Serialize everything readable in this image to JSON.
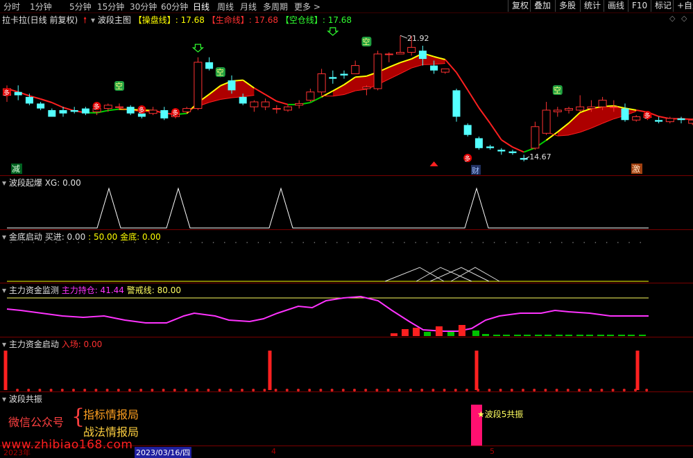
{
  "tabs": [
    "分时",
    "1分钟",
    "5分钟",
    "15分钟",
    "30分钟",
    "60分钟",
    "日线",
    "周线",
    "月线",
    "多周期",
    "更多 >"
  ],
  "active_tab": "日线",
  "right_buttons": [
    "复权",
    "叠加",
    "多股",
    "统计",
    "画线",
    "F10",
    "标记",
    "+自选"
  ],
  "main_title": {
    "stock": "拉卡拉(日线 前复权)",
    "indicator": "波段主图",
    "line1_label": "【操盘线】",
    "line1_value": ": 17.68",
    "line2_label": "【生命线】",
    "line2_value": ": 17.68",
    "line3_label": "【空仓线】",
    "line3_value": ": 17.68"
  },
  "main_annotations": {
    "high_label": "21.92",
    "low_label": "14.67",
    "jian": "减",
    "ji": "激",
    "cai": "财",
    "duo": "多",
    "kong": "空"
  },
  "panels": {
    "p1": {
      "name": "波段起爆",
      "l1": "XG: 0.00"
    },
    "p2": {
      "name": "金底启动",
      "l1": "买进: 0.00",
      "l2": ": 50.00",
      "l3": "金底: 0.00"
    },
    "p3": {
      "name": "主力资金监测",
      "l1": "主力持仓: 41.44",
      "l2": "警戒线: 80.00"
    },
    "p4": {
      "name": "主力资金启动",
      "l1": "入场: 0.00"
    },
    "p5": {
      "name": "波段共振"
    }
  },
  "overlay": {
    "wechat": "微信公众号",
    "brace": "{",
    "line1": "指标情报局",
    "line2": "战法情报局",
    "resonance": "★波段5共振",
    "website": "www.zhibiao168.com"
  },
  "xaxis": {
    "year": "2023年",
    "date": "2023/03/16/四",
    "m4": "4",
    "m5": "5"
  },
  "colors": {
    "up": "#ff3232",
    "down": "#54ffff",
    "ma_yellow": "#ffff00",
    "ma_green": "#00d000",
    "ma_red": "#ff2020",
    "band": "#c00000",
    "magenta": "#ff33ff",
    "pink": "#ff1070"
  },
  "chart_data": {
    "type": "candlestick",
    "candles": [
      {
        "o": 18.3,
        "h": 18.9,
        "l": 17.9,
        "c": 18.7
      },
      {
        "o": 18.5,
        "h": 18.9,
        "l": 18.0,
        "c": 18.3
      },
      {
        "o": 18.2,
        "h": 18.4,
        "l": 17.7,
        "c": 17.8
      },
      {
        "o": 17.8,
        "h": 17.9,
        "l": 17.4,
        "c": 17.5
      },
      {
        "o": 17.4,
        "h": 17.5,
        "l": 17.0,
        "c": 17.0
      },
      {
        "o": 17.4,
        "h": 17.6,
        "l": 17.0,
        "c": 17.2
      },
      {
        "o": 17.4,
        "h": 17.6,
        "l": 17.2,
        "c": 17.3
      },
      {
        "o": 17.5,
        "h": 17.6,
        "l": 17.1,
        "c": 17.2
      },
      {
        "o": 17.3,
        "h": 17.6,
        "l": 17.1,
        "c": 17.5
      },
      {
        "o": 17.5,
        "h": 17.8,
        "l": 17.3,
        "c": 17.7
      },
      {
        "o": 17.6,
        "h": 17.8,
        "l": 17.4,
        "c": 17.6
      },
      {
        "o": 17.6,
        "h": 17.7,
        "l": 17.1,
        "c": 17.2
      },
      {
        "o": 17.2,
        "h": 17.3,
        "l": 16.9,
        "c": 17.0
      },
      {
        "o": 17.2,
        "h": 17.6,
        "l": 17.1,
        "c": 17.4
      },
      {
        "o": 17.4,
        "h": 17.6,
        "l": 16.8,
        "c": 16.9
      },
      {
        "o": 17.0,
        "h": 17.3,
        "l": 16.9,
        "c": 17.2
      },
      {
        "o": 17.3,
        "h": 17.6,
        "l": 17.2,
        "c": 17.5
      },
      {
        "o": 17.5,
        "h": 20.6,
        "l": 17.4,
        "c": 20.3
      },
      {
        "o": 20.3,
        "h": 20.6,
        "l": 19.8,
        "c": 19.9
      },
      {
        "o": 19.8,
        "h": 19.9,
        "l": 19.4,
        "c": 19.5
      },
      {
        "o": 19.2,
        "h": 19.5,
        "l": 18.4,
        "c": 18.6
      },
      {
        "o": 18.2,
        "h": 18.4,
        "l": 17.7,
        "c": 17.8
      },
      {
        "o": 17.6,
        "h": 18.0,
        "l": 17.3,
        "c": 17.9
      },
      {
        "o": 17.6,
        "h": 18.1,
        "l": 17.4,
        "c": 17.9
      },
      {
        "o": 17.5,
        "h": 17.7,
        "l": 17.2,
        "c": 17.5
      },
      {
        "o": 17.4,
        "h": 17.7,
        "l": 17.3,
        "c": 17.6
      },
      {
        "o": 17.7,
        "h": 18.0,
        "l": 17.5,
        "c": 17.8
      },
      {
        "o": 18.0,
        "h": 18.7,
        "l": 17.9,
        "c": 18.5
      },
      {
        "o": 18.5,
        "h": 19.9,
        "l": 18.3,
        "c": 19.6
      },
      {
        "o": 19.4,
        "h": 19.8,
        "l": 19.0,
        "c": 19.3
      },
      {
        "o": 19.6,
        "h": 19.8,
        "l": 19.3,
        "c": 19.5
      },
      {
        "o": 19.6,
        "h": 20.4,
        "l": 19.6,
        "c": 20.1
      },
      {
        "o": 18.7,
        "h": 18.9,
        "l": 18.3,
        "c": 18.8
      },
      {
        "o": 18.7,
        "h": 21.0,
        "l": 18.6,
        "c": 20.8
      },
      {
        "o": 20.8,
        "h": 20.9,
        "l": 20.3,
        "c": 20.8
      },
      {
        "o": 20.8,
        "h": 21.9,
        "l": 20.8,
        "c": 20.9
      },
      {
        "o": 20.9,
        "h": 21.9,
        "l": 20.7,
        "c": 21.2
      },
      {
        "o": 21.0,
        "h": 21.3,
        "l": 20.1,
        "c": 20.5
      },
      {
        "o": 20.1,
        "h": 20.4,
        "l": 19.6,
        "c": 19.8
      },
      {
        "o": 19.7,
        "h": 19.9,
        "l": 19.6,
        "c": 19.9
      },
      {
        "o": 18.6,
        "h": 18.7,
        "l": 16.7,
        "c": 17.0
      },
      {
        "o": 16.5,
        "h": 16.6,
        "l": 15.8,
        "c": 15.9
      },
      {
        "o": 15.7,
        "h": 15.8,
        "l": 15.0,
        "c": 15.1
      },
      {
        "o": 15.2,
        "h": 15.3,
        "l": 15.0,
        "c": 15.1
      },
      {
        "o": 15.0,
        "h": 15.1,
        "l": 14.7,
        "c": 14.9
      },
      {
        "o": 14.9,
        "h": 15.0,
        "l": 14.7,
        "c": 14.8
      },
      {
        "o": 14.5,
        "h": 14.7,
        "l": 14.3,
        "c": 14.4
      },
      {
        "o": 15.1,
        "h": 16.7,
        "l": 15.0,
        "c": 16.4
      },
      {
        "o": 16.0,
        "h": 17.9,
        "l": 15.9,
        "c": 17.4
      },
      {
        "o": 17.3,
        "h": 17.6,
        "l": 17.0,
        "c": 17.4
      },
      {
        "o": 17.4,
        "h": 17.6,
        "l": 17.2,
        "c": 17.5
      },
      {
        "o": 17.4,
        "h": 18.3,
        "l": 17.3,
        "c": 17.6
      },
      {
        "o": 17.5,
        "h": 18.0,
        "l": 17.3,
        "c": 17.6
      },
      {
        "o": 17.6,
        "h": 18.2,
        "l": 17.4,
        "c": 18.0
      },
      {
        "o": 17.6,
        "h": 18.0,
        "l": 17.3,
        "c": 17.6
      },
      {
        "o": 17.5,
        "h": 17.8,
        "l": 16.7,
        "c": 16.8
      },
      {
        "o": 16.8,
        "h": 17.1,
        "l": 16.7,
        "c": 17.0
      },
      {
        "o": 17.0,
        "h": 17.2,
        "l": 16.8,
        "c": 17.0
      },
      {
        "o": 16.8,
        "h": 17.0,
        "l": 16.6,
        "c": 16.7
      },
      {
        "o": 16.7,
        "h": 17.0,
        "l": 16.6,
        "c": 16.9
      },
      {
        "o": 16.9,
        "h": 17.0,
        "l": 16.6,
        "c": 16.8
      },
      {
        "o": 16.6,
        "h": 16.9,
        "l": 16.5,
        "c": 16.8
      }
    ],
    "ylim": [
      14.0,
      22.6
    ],
    "high": 21.92,
    "low": 14.67
  }
}
